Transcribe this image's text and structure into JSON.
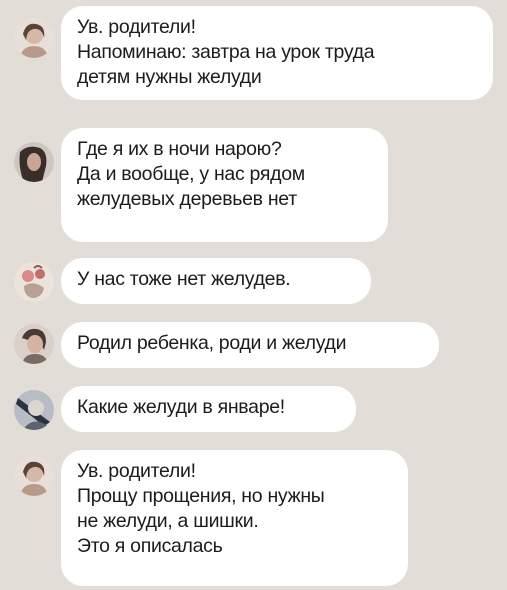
{
  "chat": {
    "messages": [
      {
        "avatar_icon": "user-avatar-1-icon",
        "lines": [
          "Ув. родители!",
          "Напоминаю: завтра на урок труда",
          "детям нужны желуди"
        ]
      },
      {
        "avatar_icon": "user-avatar-2-icon",
        "lines": [
          "Где я их в ночи нарою?",
          "Да и вообще, у нас рядом",
          "желудевых деревьев нет"
        ]
      },
      {
        "avatar_icon": "user-avatar-3-icon",
        "lines": [
          "У нас тоже нет желудев."
        ]
      },
      {
        "avatar_icon": "user-avatar-4-icon",
        "lines": [
          "Родил ребенка, роди и желуди"
        ]
      },
      {
        "avatar_icon": "user-avatar-5-icon",
        "lines": [
          "Какие желуди в январе!"
        ]
      },
      {
        "avatar_icon": "user-avatar-1-icon",
        "lines": [
          "Ув. родители!",
          "Прощу прощения, но нужны",
          "не желуди, а шишки.",
          "Это я описалась"
        ]
      }
    ]
  },
  "colors": {
    "background": "#e3ddd7",
    "bubble": "#ffffff",
    "text": "#1c1c1c"
  }
}
